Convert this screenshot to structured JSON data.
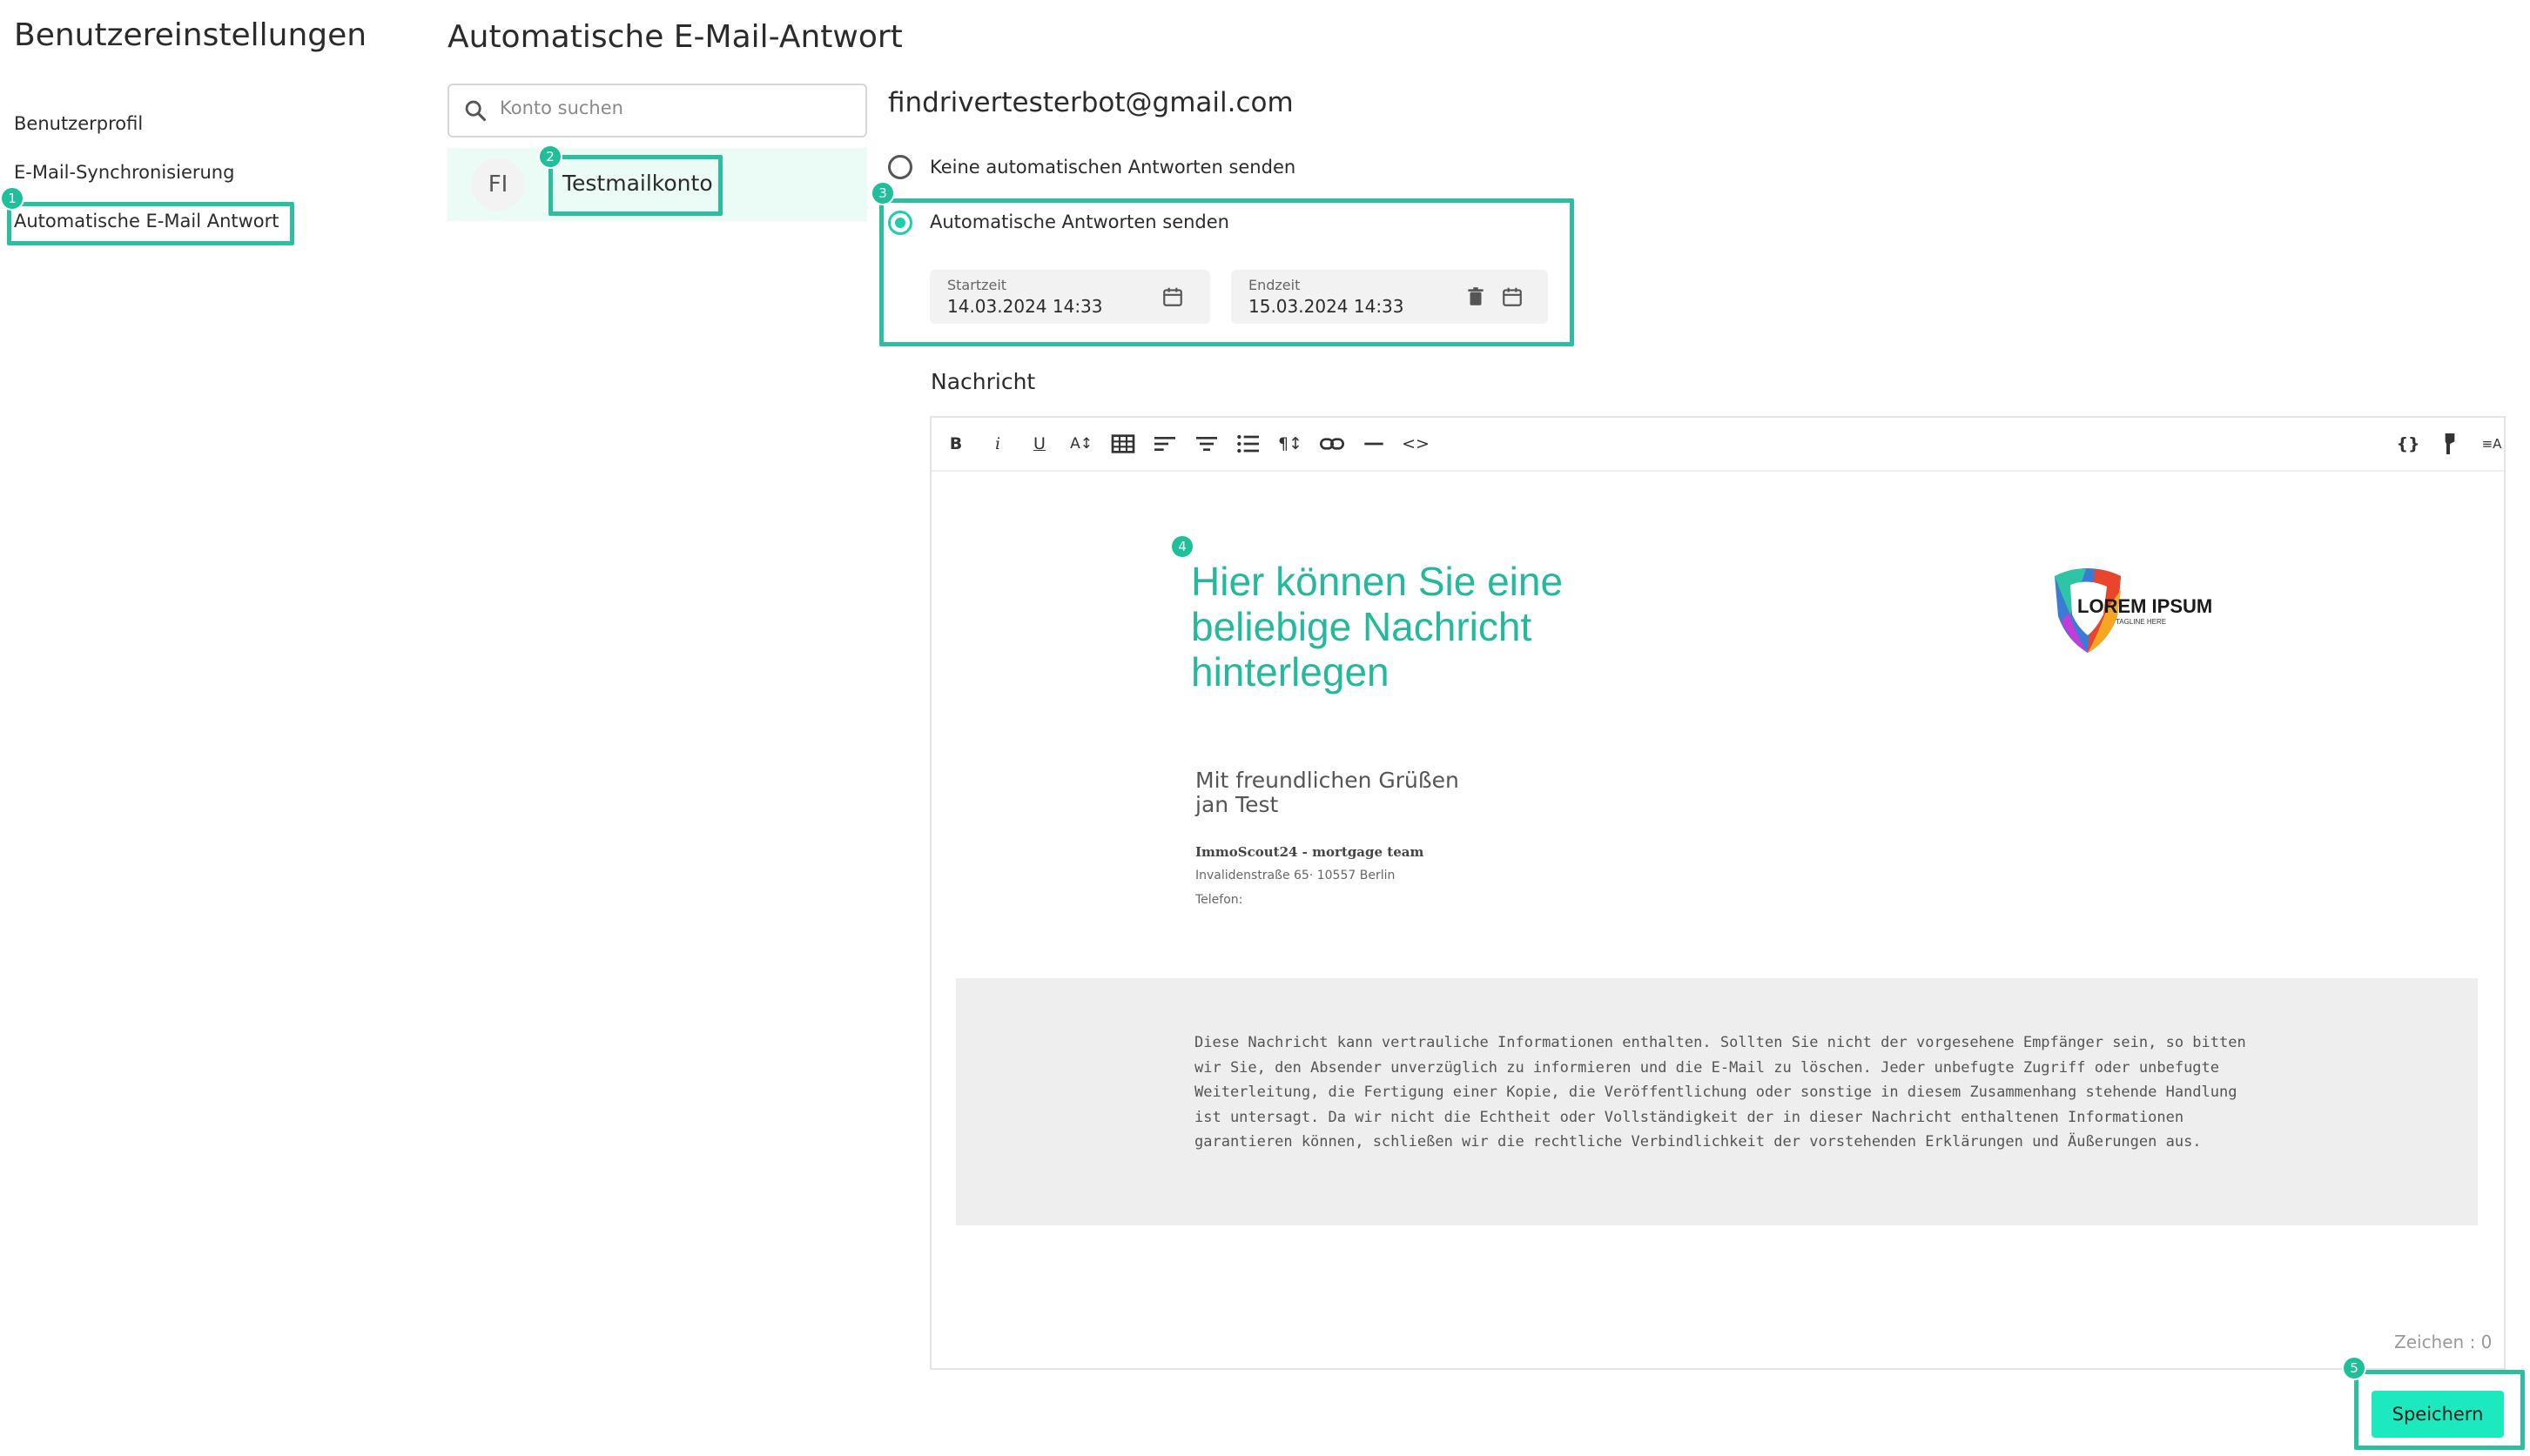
{
  "sidebar": {
    "title": "Benutzereinstellungen",
    "items": [
      {
        "label": "Benutzerprofil"
      },
      {
        "label": "E-Mail-Synchronisierung"
      },
      {
        "label": "Automatische E-Mail Antwort"
      }
    ]
  },
  "main": {
    "title": "Automatische E-Mail-Antwort",
    "search": {
      "placeholder": "Konto suchen",
      "value": ""
    },
    "account": {
      "initials": "FI",
      "name": "Testmailkonto"
    },
    "email": "findrivertesterbot@gmail.com",
    "options": {
      "none_label": "Keine automatischen Antworten senden",
      "send_label": "Automatische Antworten senden",
      "selected": "send"
    },
    "start": {
      "label": "Startzeit",
      "value": "14.03.2024 14:33"
    },
    "end": {
      "label": "Endzeit",
      "value": "15.03.2024 14:33"
    },
    "message_label": "Nachricht",
    "toolbar_icons": [
      "bold-icon",
      "italic-icon",
      "underline-icon",
      "font-size-icon",
      "table-icon",
      "align-left-icon",
      "align-center-icon",
      "list-icon",
      "paragraph-icon",
      "link-icon",
      "horizontal-rule-icon",
      "code-icon",
      "braces-icon",
      "format-paint-icon",
      "text-direction-icon"
    ],
    "editor": {
      "headline": "Hier können Sie eine beliebige Nachricht hinterlegen",
      "logo_text": "LOREM IPSUM",
      "logo_tagline": "TAGLINE HERE",
      "greeting": "Mit freundlichen Grüßen",
      "signer": "jan Test",
      "company": "ImmoScout24 - mortgage team",
      "address": "Invalidenstraße 65· 10557 Berlin",
      "phone": "Telefon:",
      "disclaimer": "Diese Nachricht kann vertrauliche Informationen enthalten. Sollten Sie nicht der vorgesehene Empfänger sein, so bitten wir Sie, den Absender unverzüglich zu informieren und die E-Mail zu löschen. Jeder unbefugte Zugriff oder unbefugte Weiterleitung, die Fertigung einer Kopie, die Veröffentlichung oder sonstige in diesem Zusammenhang stehende Handlung ist untersagt. Da wir nicht die Echtheit oder Vollständigkeit der in dieser Nachricht enthaltenen Informationen garantieren können, schließen wir die rechtliche Verbindlichkeit der vorstehenden Erklärungen und Äußerungen aus."
    },
    "counter": "Zeichen : 0",
    "save_label": "Speichern"
  },
  "annotations": [
    "1",
    "2",
    "3",
    "4",
    "5"
  ],
  "colors": {
    "accent": "#1fcfa8",
    "annotation": "#2bbfa0",
    "save_button": "#1de9bf",
    "headline": "#23b99a"
  }
}
